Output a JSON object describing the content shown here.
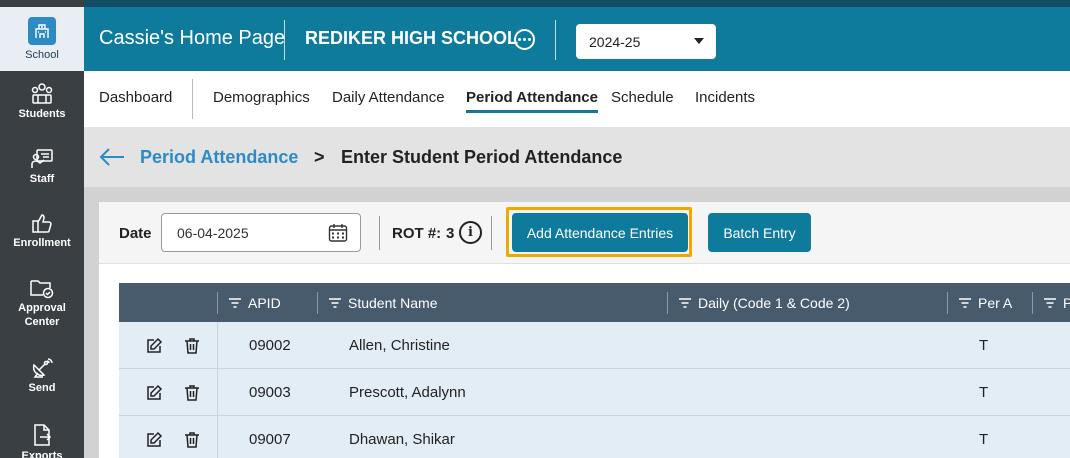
{
  "rail": {
    "items": [
      {
        "label": "School",
        "icon": "school-icon",
        "active": true
      },
      {
        "label": "Students",
        "icon": "students-icon"
      },
      {
        "label": "Staff",
        "icon": "staff-icon"
      },
      {
        "label": "Enrollment",
        "icon": "thumbs-up-icon"
      },
      {
        "label": "Approval Center",
        "icon": "folder-check-icon"
      },
      {
        "label": "Send",
        "icon": "satellite-icon"
      },
      {
        "label": "Exports",
        "icon": "export-icon"
      }
    ]
  },
  "header": {
    "home_title": "Cassie's Home Page",
    "school_name": "REDIKER HIGH SCHOOL",
    "year": "2024-25"
  },
  "tabs": [
    {
      "label": "Dashboard"
    },
    {
      "label": "Demographics"
    },
    {
      "label": "Daily Attendance"
    },
    {
      "label": "Period Attendance",
      "active": true
    },
    {
      "label": "Schedule"
    },
    {
      "label": "Incidents"
    }
  ],
  "breadcrumb": {
    "parent": "Period Attendance",
    "separator": ">",
    "current": "Enter Student Period Attendance"
  },
  "filters": {
    "date_label": "Date",
    "date_value": "06-04-2025",
    "rot_label": "ROT #:",
    "rot_value": "3",
    "info_glyph": "i",
    "add_button": "Add Attendance Entries",
    "batch_button": "Batch Entry"
  },
  "table": {
    "columns": [
      "APID",
      "Student Name",
      "Daily (Code 1 & Code 2)",
      "Per A",
      "P"
    ],
    "rows": [
      {
        "apid": "09002",
        "name": "Allen, Christine",
        "daily": "",
        "per_a": "T"
      },
      {
        "apid": "09003",
        "name": "Prescott, Adalynn",
        "daily": "",
        "per_a": "T"
      },
      {
        "apid": "09007",
        "name": "Dhawan, Shikar",
        "daily": "",
        "per_a": "T"
      }
    ]
  },
  "colors": {
    "primary": "#0f7b9c",
    "rail": "#3a3f44",
    "link": "#2d8bc4",
    "focus": "#f0a800",
    "table_header": "#485b6c",
    "row_bg": "#e3edf6"
  }
}
